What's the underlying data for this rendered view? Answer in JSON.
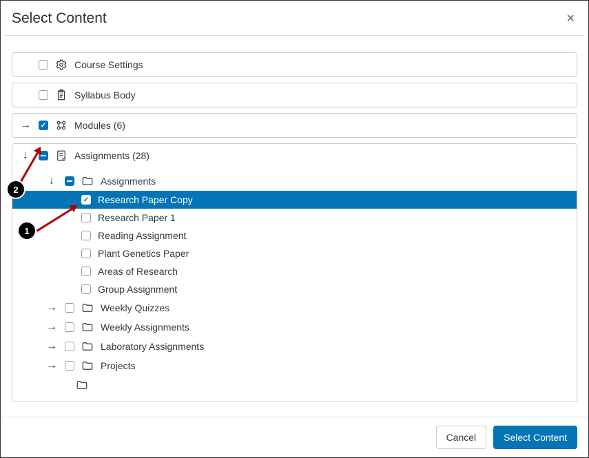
{
  "header": {
    "title": "Select Content"
  },
  "rows": {
    "course_settings": "Course Settings",
    "syllabus_body": "Syllabus Body",
    "modules": "Modules (6)",
    "assignments_group": "Assignments (28)"
  },
  "assignments_subgroup": "Assignments",
  "items": [
    "Research Paper Copy",
    "Research Paper 1",
    "Reading Assignment",
    "Plant Genetics Paper",
    "Areas of Research",
    "Group Assignment"
  ],
  "subgroups": [
    "Weekly Quizzes",
    "Weekly Assignments",
    "Laboratory Assignments",
    "Projects"
  ],
  "footer": {
    "cancel": "Cancel",
    "select": "Select Content"
  },
  "callouts": {
    "one": "1",
    "two": "2"
  }
}
